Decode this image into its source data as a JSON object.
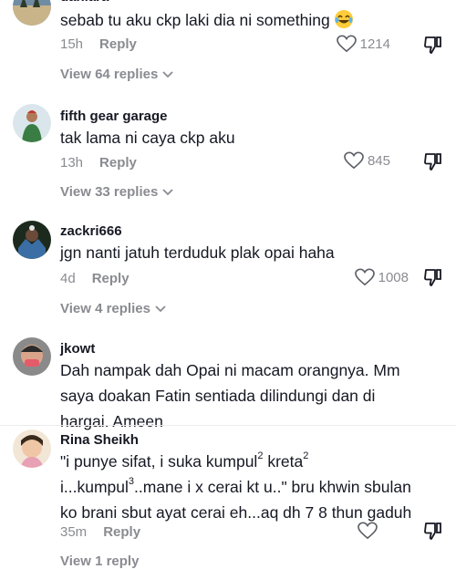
{
  "comments": [
    {
      "username": "dahlara",
      "text": "sebab tu aku ckp laki dia ni something",
      "emoji": "face-with-tears-of-joy",
      "time": "15h",
      "reply_label": "Reply",
      "likes": "1214",
      "view_replies": "View 64 replies"
    },
    {
      "username": "fifth gear garage",
      "text": "tak lama ni caya ckp aku",
      "time": "13h",
      "reply_label": "Reply",
      "likes": "845",
      "view_replies": "View 33 replies"
    },
    {
      "username": "zackri666",
      "text": "jgn nanti jatuh terduduk plak opai haha",
      "time": "4d",
      "reply_label": "Reply",
      "likes": "1008",
      "view_replies": "View 4 replies"
    },
    {
      "username": "jkowt",
      "text_line1": "Dah nampak dah Opai ni macam orangnya. Mm",
      "text_line2": "saya doakan Fatin sentiada dilindungi dan di",
      "text_line3": "hargai. Ameen"
    },
    {
      "username": "Rina Sheikh",
      "text_l1_a": "\"i punye sifat, i suka kumpul",
      "sup1": "2",
      "text_l1_b": " kreta",
      "sup2": "2",
      "text_l2_a": "i...kumpul",
      "sup3": "3",
      "text_l2_b": "..mane i x cerai kt u..\" bru khwin sbulan",
      "text_l3": "ko brani sbut ayat cerai eh...aq dh 7 8 thun gaduh",
      "time": "35m",
      "reply_label": "Reply",
      "view_replies": "View 1 reply"
    }
  ],
  "colors": {
    "text": "#161823",
    "muted": "#8a8b91"
  }
}
